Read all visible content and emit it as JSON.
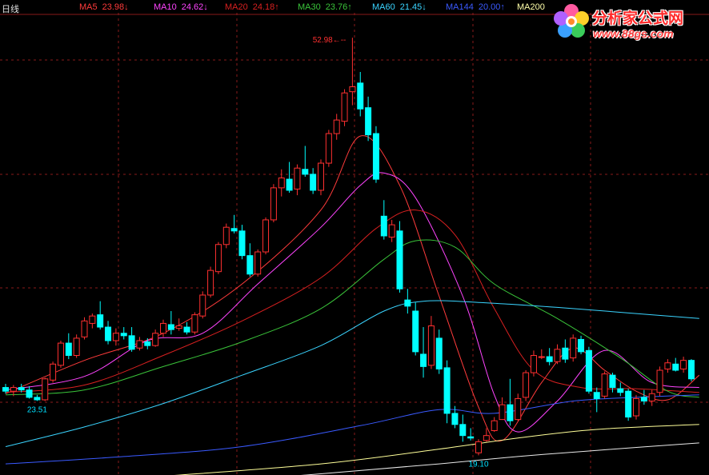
{
  "header": {
    "period_label": "日线",
    "ma": [
      {
        "name": "MA5",
        "value": "23.98",
        "arrow": "↓",
        "color": "#ff3b3b"
      },
      {
        "name": "MA10",
        "value": "24.62",
        "arrow": "↓",
        "color": "#ff44ff"
      },
      {
        "name": "MA20",
        "value": "24.18",
        "arrow": "↑",
        "color": "#d82020"
      },
      {
        "name": "MA30",
        "value": "23.76",
        "arrow": "↑",
        "color": "#3ac43a"
      },
      {
        "name": "MA60",
        "value": "21.45",
        "arrow": "↓",
        "color": "#3ad4ff"
      },
      {
        "name": "MA144",
        "value": "20.00",
        "arrow": "↑",
        "color": "#3a5aff"
      },
      {
        "name": "MA200",
        "value": "",
        "arrow": "",
        "color": "#ffffaa"
      }
    ]
  },
  "logo": {
    "title": "分析家公式网",
    "url": "www.88gs.com"
  },
  "chart_data": {
    "type": "candlestick",
    "y_range": [
      17.5,
      55
    ],
    "grid": true,
    "annotations": [
      {
        "label": "52.98",
        "price": 52.98,
        "kind": "high"
      },
      {
        "label": "23.51",
        "price": 23.51,
        "kind": "low"
      },
      {
        "label": "19.10",
        "price": 19.1,
        "kind": "low"
      }
    ],
    "candles": [
      [
        24.6,
        24.9,
        24.1,
        24.3
      ],
      [
        24.3,
        24.8,
        23.9,
        24.6
      ],
      [
        24.6,
        24.9,
        24.2,
        24.4
      ],
      [
        24.4,
        24.7,
        23.7,
        23.8
      ],
      [
        23.8,
        24.0,
        23.51,
        23.6
      ],
      [
        23.6,
        25.4,
        23.5,
        25.3
      ],
      [
        25.2,
        26.7,
        25.0,
        26.5
      ],
      [
        26.4,
        28.4,
        26.2,
        28.2
      ],
      [
        28.2,
        29.0,
        26.9,
        27.2
      ],
      [
        27.2,
        28.9,
        27.0,
        28.6
      ],
      [
        28.7,
        30.3,
        28.5,
        30.0
      ],
      [
        29.8,
        30.6,
        29.4,
        30.4
      ],
      [
        30.5,
        31.6,
        29.3,
        29.5
      ],
      [
        29.5,
        30.0,
        28.1,
        28.4
      ],
      [
        28.4,
        29.4,
        28.0,
        29.0
      ],
      [
        29.0,
        29.5,
        28.5,
        28.8
      ],
      [
        28.8,
        29.5,
        27.5,
        27.7
      ],
      [
        27.8,
        28.7,
        27.6,
        28.4
      ],
      [
        28.3,
        28.6,
        27.7,
        28.0
      ],
      [
        28.0,
        29.3,
        27.9,
        29.0
      ],
      [
        29.0,
        30.1,
        28.7,
        29.8
      ],
      [
        29.7,
        30.8,
        28.9,
        29.3
      ],
      [
        29.4,
        30.2,
        29.2,
        29.6
      ],
      [
        29.5,
        29.9,
        28.9,
        29.1
      ],
      [
        29.1,
        30.7,
        28.9,
        30.5
      ],
      [
        30.4,
        32.4,
        30.2,
        32.1
      ],
      [
        32.1,
        34.4,
        31.9,
        34.1
      ],
      [
        34.0,
        36.4,
        33.8,
        36.2
      ],
      [
        36.2,
        37.9,
        35.9,
        37.6
      ],
      [
        37.5,
        38.6,
        37.1,
        37.3
      ],
      [
        37.3,
        37.8,
        35.0,
        35.3
      ],
      [
        35.3,
        36.3,
        33.6,
        33.8
      ],
      [
        33.8,
        35.8,
        33.6,
        35.6
      ],
      [
        35.6,
        38.4,
        35.4,
        38.2
      ],
      [
        38.2,
        41.1,
        38.0,
        40.8
      ],
      [
        40.8,
        42.3,
        40.1,
        41.6
      ],
      [
        41.5,
        42.9,
        40.4,
        40.6
      ],
      [
        40.7,
        42.7,
        40.2,
        42.4
      ],
      [
        42.3,
        44.2,
        41.7,
        41.9
      ],
      [
        41.9,
        42.4,
        40.3,
        40.6
      ],
      [
        40.6,
        43.1,
        40.2,
        42.8
      ],
      [
        42.8,
        45.5,
        42.5,
        45.2
      ],
      [
        45.2,
        46.8,
        44.7,
        46.3
      ],
      [
        46.2,
        48.8,
        45.8,
        48.5
      ],
      [
        48.6,
        52.98,
        47.5,
        49.0
      ],
      [
        49.3,
        50.2,
        46.6,
        47.2
      ],
      [
        47.3,
        48.2,
        44.6,
        45.1
      ],
      [
        45.2,
        45.8,
        41.2,
        41.5
      ],
      [
        38.5,
        39.8,
        36.6,
        36.9
      ],
      [
        36.8,
        38.2,
        36.4,
        37.8
      ],
      [
        37.3,
        38.1,
        32.3,
        32.6
      ],
      [
        31.7,
        32.6,
        30.6,
        31.2
      ],
      [
        30.8,
        31.5,
        27.2,
        27.5
      ],
      [
        27.3,
        29.5,
        25.4,
        26.3
      ],
      [
        26.4,
        30.4,
        26.1,
        29.6
      ],
      [
        28.6,
        29.3,
        25.7,
        26.1
      ],
      [
        26.2,
        26.8,
        21.7,
        22.5
      ],
      [
        22.5,
        23.1,
        21.3,
        21.6
      ],
      [
        21.6,
        22.4,
        20.2,
        20.7
      ],
      [
        20.6,
        21.3,
        20.3,
        20.5
      ],
      [
        19.3,
        20.4,
        19.1,
        20.2
      ],
      [
        20.3,
        21.3,
        20.2,
        20.7
      ],
      [
        21.1,
        22.2,
        21.0,
        21.9
      ],
      [
        22.0,
        23.8,
        22.1,
        23.2
      ],
      [
        23.2,
        25.3,
        21.5,
        21.9
      ],
      [
        22.0,
        24.1,
        21.9,
        23.7
      ],
      [
        23.8,
        26.0,
        23.5,
        25.8
      ],
      [
        25.8,
        27.6,
        25.5,
        27.2
      ],
      [
        27.1,
        27.7,
        26.9,
        27.1
      ],
      [
        27.1,
        27.8,
        26.4,
        26.7
      ],
      [
        26.7,
        28.1,
        26.5,
        27.7
      ],
      [
        27.8,
        28.5,
        26.6,
        26.9
      ],
      [
        27.0,
        28.9,
        26.7,
        28.6
      ],
      [
        28.5,
        28.8,
        27.3,
        27.5
      ],
      [
        27.6,
        27.9,
        24.1,
        24.3
      ],
      [
        24.2,
        24.6,
        22.6,
        23.7
      ],
      [
        23.9,
        25.9,
        23.7,
        25.7
      ],
      [
        25.6,
        25.8,
        24.2,
        24.6
      ],
      [
        24.5,
        25.0,
        23.9,
        24.2
      ],
      [
        24.3,
        24.5,
        21.9,
        22.2
      ],
      [
        22.3,
        24.0,
        22.0,
        23.7
      ],
      [
        23.8,
        24.4,
        23.2,
        23.5
      ],
      [
        23.5,
        24.4,
        23.1,
        24.1
      ],
      [
        24.2,
        26.3,
        23.9,
        26.0
      ],
      [
        26.1,
        26.9,
        25.8,
        26.6
      ],
      [
        26.5,
        27.0,
        25.9,
        26.0
      ],
      [
        26.1,
        27.1,
        25.8,
        26.8
      ],
      [
        26.8,
        26.9,
        25.1,
        25.3
      ]
    ],
    "ma_series": [
      {
        "name": "MA5",
        "color": "#ff3b3b",
        "start_index": 4,
        "points": [
          [
            0,
            24.1
          ],
          [
            10,
            26.8
          ],
          [
            20,
            29.0
          ],
          [
            30,
            33.0
          ],
          [
            40,
            39.0
          ],
          [
            45,
            45.0
          ],
          [
            50,
            41.0
          ],
          [
            55,
            32.0
          ],
          [
            60,
            23.0
          ],
          [
            63,
            20.3
          ],
          [
            68,
            25.0
          ],
          [
            72,
            27.8
          ],
          [
            76,
            26.0
          ],
          [
            80,
            24.3
          ],
          [
            84,
            23.6
          ],
          [
            88,
            25.6
          ]
        ]
      },
      {
        "name": "MA10",
        "color": "#ff44ff",
        "start_index": 0,
        "points": [
          [
            0,
            24.4
          ],
          [
            10,
            25.5
          ],
          [
            18,
            28.4
          ],
          [
            25,
            29.0
          ],
          [
            32,
            33.0
          ],
          [
            40,
            37.6
          ],
          [
            45,
            41.0
          ],
          [
            48,
            42.0
          ],
          [
            52,
            40.0
          ],
          [
            58,
            32.0
          ],
          [
            62,
            24.0
          ],
          [
            65,
            21.0
          ],
          [
            70,
            23.5
          ],
          [
            76,
            27.6
          ],
          [
            82,
            25.0
          ],
          [
            88,
            24.6
          ]
        ]
      },
      {
        "name": "MA20",
        "color": "#d82020",
        "start_index": 0,
        "points": [
          [
            0,
            24.2
          ],
          [
            10,
            24.8
          ],
          [
            20,
            27.2
          ],
          [
            30,
            30.0
          ],
          [
            40,
            33.5
          ],
          [
            47,
            37.5
          ],
          [
            52,
            39.0
          ],
          [
            57,
            37.0
          ],
          [
            62,
            31.0
          ],
          [
            67,
            26.0
          ],
          [
            73,
            24.6
          ],
          [
            80,
            24.5
          ],
          [
            88,
            24.2
          ]
        ]
      },
      {
        "name": "MA30",
        "color": "#3ac43a",
        "start_index": 0,
        "points": [
          [
            0,
            24.0
          ],
          [
            10,
            24.4
          ],
          [
            20,
            26.3
          ],
          [
            30,
            28.3
          ],
          [
            40,
            31.0
          ],
          [
            48,
            35.0
          ],
          [
            52,
            36.5
          ],
          [
            57,
            36.0
          ],
          [
            62,
            33.0
          ],
          [
            70,
            30.2
          ],
          [
            78,
            27.0
          ],
          [
            84,
            24.3
          ],
          [
            88,
            23.8
          ]
        ]
      },
      {
        "name": "MA60",
        "color": "#3ad4ff",
        "start_index": 0,
        "points": [
          [
            0,
            19.8
          ],
          [
            10,
            21.4
          ],
          [
            20,
            23.3
          ],
          [
            30,
            25.6
          ],
          [
            40,
            28.0
          ],
          [
            48,
            30.8
          ],
          [
            53,
            31.6
          ],
          [
            60,
            31.5
          ],
          [
            70,
            31.1
          ],
          [
            80,
            30.6
          ],
          [
            88,
            30.2
          ]
        ]
      },
      {
        "name": "MA144",
        "color": "#3a5aff",
        "start_index": 0,
        "points": [
          [
            0,
            18.4
          ],
          [
            15,
            19.0
          ],
          [
            30,
            19.8
          ],
          [
            45,
            21.5
          ],
          [
            55,
            22.8
          ],
          [
            62,
            22.5
          ],
          [
            72,
            23.5
          ],
          [
            80,
            23.8
          ],
          [
            88,
            24.0
          ]
        ]
      },
      {
        "name": "MA200",
        "color": "#ffff99",
        "start_index": 0,
        "points": [
          [
            0,
            16.5
          ],
          [
            20,
            17.4
          ],
          [
            40,
            18.4
          ],
          [
            55,
            19.6
          ],
          [
            65,
            20.5
          ],
          [
            75,
            21.2
          ],
          [
            88,
            21.6
          ]
        ]
      },
      {
        "name": "MA250",
        "color": "#e8e8e8",
        "start_index": 0,
        "points": [
          [
            0,
            15.8
          ],
          [
            20,
            16.6
          ],
          [
            40,
            17.6
          ],
          [
            55,
            18.4
          ],
          [
            65,
            19.0
          ],
          [
            75,
            19.5
          ],
          [
            88,
            20.1
          ]
        ]
      }
    ]
  }
}
